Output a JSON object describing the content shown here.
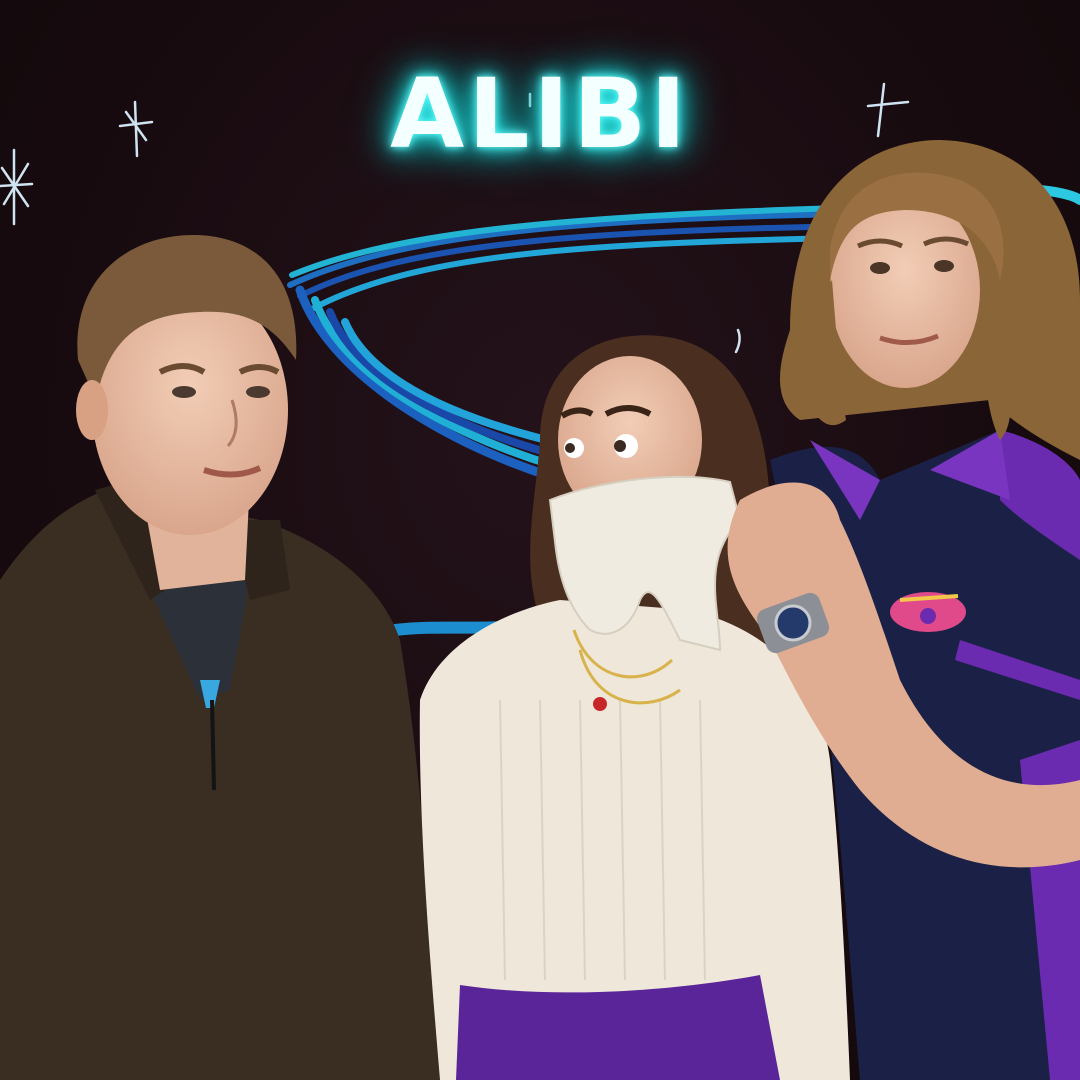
{
  "poster": {
    "title": "ALIBI",
    "colors": {
      "background": "#170a0e",
      "neon_title": "#5ff5f5",
      "swirl_blue": "#1e8fd6",
      "swirl_teal": "#1cb7c9",
      "purple": "#6b2bb0"
    }
  }
}
